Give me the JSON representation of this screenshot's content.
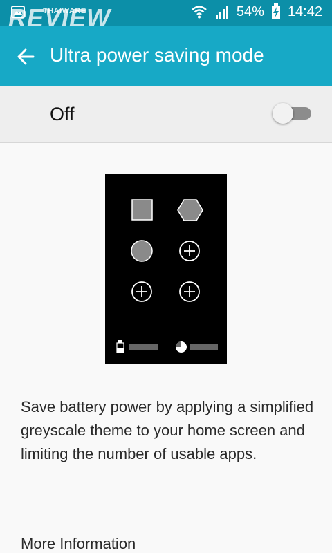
{
  "status_bar": {
    "battery": "54%",
    "time": "14:42"
  },
  "watermark": {
    "brand_small": "THAIWARE",
    "brand_large": "REVIEW"
  },
  "app_bar": {
    "title": "Ultra power saving mode"
  },
  "toggle": {
    "label": "Off",
    "state": "off"
  },
  "description": "Save battery power by applying a simplified greyscale theme to your home screen and limiting the number of usable apps.",
  "more_info_label": "More Information",
  "colors": {
    "status_bar": "#0c8fa8",
    "app_bar": "#17a9c6",
    "toggle_row": "#eeeeee",
    "switch_track_off": "#8c8c8c"
  }
}
